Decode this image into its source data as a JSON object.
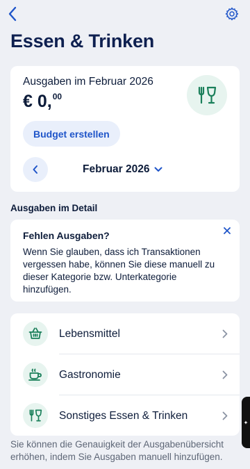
{
  "header": {
    "title": "Essen & Trinken"
  },
  "summary": {
    "title": "Ausgaben im Februar 2026",
    "currency": "€",
    "amount_main": "0,",
    "amount_cents": "00",
    "budget_button_label": "Budget erstellen",
    "month_label": "Februar 2026",
    "category_icon": "cutlery-glass-icon"
  },
  "details": {
    "section_label": "Ausgaben im Detail"
  },
  "hint": {
    "title": "Fehlen Ausgaben?",
    "body": "Wenn Sie glauben, dass ich Transaktionen vergessen habe, können Sie diese manuell zu dieser Kategorie bzw. Unterkategorie hinzufügen."
  },
  "subcategories": [
    {
      "label": "Lebensmittel",
      "icon": "basket-icon"
    },
    {
      "label": "Gastronomie",
      "icon": "coffee-cup-icon"
    },
    {
      "label": "Sonstiges Essen & Trinken",
      "icon": "cutlery-glass-icon"
    }
  ],
  "footer": {
    "note": "Sie können die Genauigkeit der Ausgabenübersicht erhöhen, indem Sie Ausgaben manuell hinzufügen."
  },
  "colors": {
    "accent": "#1f55c9",
    "icon_green": "#1a7f5a",
    "background": "#eef0f5",
    "title": "#0e2050"
  }
}
